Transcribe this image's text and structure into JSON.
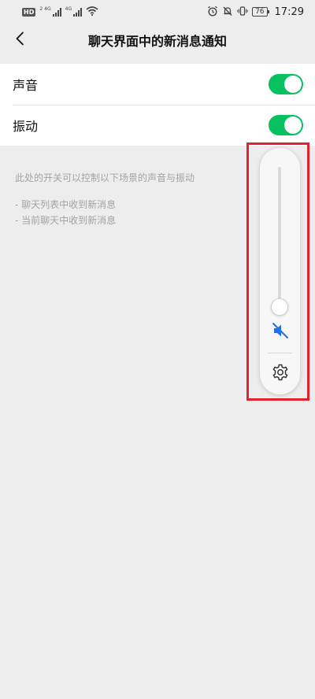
{
  "status_bar": {
    "hd_badge": "HD",
    "sim1_tag": "2",
    "network1": "4G",
    "network2": "4G",
    "battery": "76",
    "time": "17:29"
  },
  "nav": {
    "title": "聊天界面中的新消息通知"
  },
  "settings": [
    {
      "label": "声音",
      "enabled": true
    },
    {
      "label": "振动",
      "enabled": true
    }
  ],
  "description": {
    "line1": "此处的开关可以控制以下场景的声音与振动",
    "item1": "- 聊天列表中收到新消息",
    "item2": "- 当前聊天中收到新消息"
  },
  "volume_panel": {
    "level": 0,
    "muted": true,
    "icons": [
      "speaker-muted-icon",
      "gear-icon"
    ]
  },
  "colors": {
    "accent": "#07c160",
    "highlight": "#e0232e",
    "volume_icon": "#1f6ff0"
  }
}
